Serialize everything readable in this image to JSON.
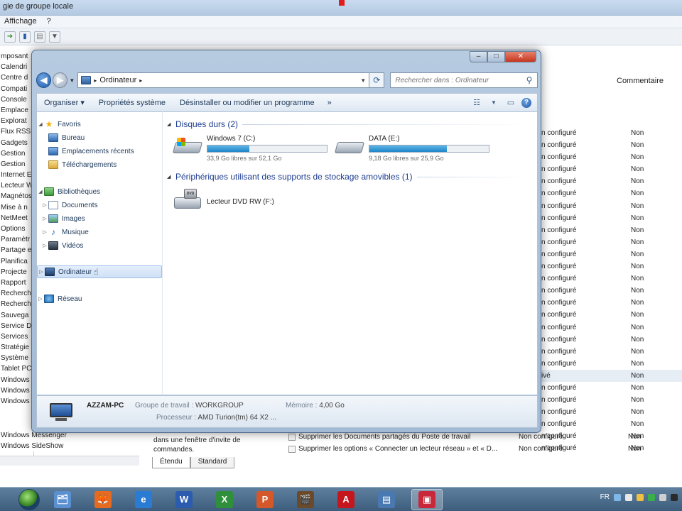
{
  "bg": {
    "title": "gie de groupe locale",
    "menu": [
      "Affichage",
      "?"
    ],
    "tree": [
      "mposant",
      "Calendri",
      "Centre d",
      "Compati",
      "Console",
      "Emplace",
      "Explorat",
      "Flux RSS",
      "Gadgets",
      "Gestion",
      "Gestion",
      "Internet E",
      "Lecteur W",
      "Magnétos",
      "Mise à n",
      "NetMeet",
      "Options",
      "Paramètr",
      "Partage e",
      "Planifica",
      "Projecte",
      "Rapport",
      "Recherch",
      "Recherch",
      "Sauvega",
      "Service D",
      "Services",
      "Stratégie",
      "Système",
      "Tablet PC",
      "Windows",
      "Windows",
      "Windows"
    ],
    "tree_tail": [
      "Windows Messenger",
      "Windows SideShow"
    ],
    "col_comment": "Commentaire",
    "rows": [
      {
        "state": "n configuré",
        "comment": "Non"
      },
      {
        "state": "n configuré",
        "comment": "Non"
      },
      {
        "state": "n configuré",
        "comment": "Non"
      },
      {
        "state": "n configuré",
        "comment": "Non"
      },
      {
        "state": "n configuré",
        "comment": "Non"
      },
      {
        "state": "n configuré",
        "comment": "Non"
      },
      {
        "state": "n configuré",
        "comment": "Non"
      },
      {
        "state": "n configuré",
        "comment": "Non"
      },
      {
        "state": "n configuré",
        "comment": "Non"
      },
      {
        "state": "n configuré",
        "comment": "Non"
      },
      {
        "state": "n configuré",
        "comment": "Non"
      },
      {
        "state": "n configuré",
        "comment": "Non"
      },
      {
        "state": "n configuré",
        "comment": "Non"
      },
      {
        "state": "n configuré",
        "comment": "Non"
      },
      {
        "state": "n configuré",
        "comment": "Non"
      },
      {
        "state": "n configuré",
        "comment": "Non"
      },
      {
        "state": "n configuré",
        "comment": "Non"
      },
      {
        "state": "n configuré",
        "comment": "Non"
      },
      {
        "state": "n configuré",
        "comment": "Non"
      },
      {
        "state": "n configuré",
        "comment": "Non"
      },
      {
        "state": "ivé",
        "comment": "Non"
      },
      {
        "state": "n configuré",
        "comment": "Non"
      },
      {
        "state": "n configuré",
        "comment": "Non"
      },
      {
        "state": "n configuré",
        "comment": "Non"
      },
      {
        "state": "n configuré",
        "comment": "Non"
      },
      {
        "state": "n configuré",
        "comment": "Non"
      },
      {
        "state": "n configuré",
        "comment": "Non"
      }
    ],
    "desc": "dans une fenêtre d'invite de commandes.",
    "policies": [
      {
        "name": "Supprimer les Documents partagés du Poste de travail",
        "state": "Non configuré",
        "comment": "Non"
      },
      {
        "name": "Supprimer les options « Connecter un lecteur réseau » et « D...",
        "state": "Non configuré",
        "comment": "Non"
      }
    ],
    "tabs": [
      "Étendu",
      "Standard"
    ]
  },
  "explorer": {
    "nav_arrow_back": "◀",
    "nav_arrow_fwd": "▶",
    "address": "Ordinateur",
    "search_placeholder": "Rechercher dans : Ordinateur",
    "commands": [
      "Organiser ▾",
      "Propriétés système",
      "Désinstaller ou modifier un programme"
    ],
    "cmd_more": "»",
    "nav_items": [
      {
        "label": "Favoris",
        "icon": "star-icon"
      },
      {
        "label": "Bureau",
        "icon": "desktop-icon"
      },
      {
        "label": "Emplacements récents",
        "icon": "recent-places-icon"
      },
      {
        "label": "Téléchargements",
        "icon": "downloads-icon"
      },
      {
        "label": "Bibliothèques",
        "icon": "libraries-icon"
      },
      {
        "label": "Documents",
        "icon": "documents-icon"
      },
      {
        "label": "Images",
        "icon": "images-icon"
      },
      {
        "label": "Musique",
        "icon": "music-icon"
      },
      {
        "label": "Vidéos",
        "icon": "videos-icon"
      },
      {
        "label": "Ordinateur",
        "icon": "computer-icon"
      },
      {
        "label": "Réseau",
        "icon": "network-icon"
      }
    ],
    "groups": {
      "hdd": "Disques durs (2)",
      "removable": "Périphériques utilisant des supports de stockage amovibles (1)"
    },
    "drives": [
      {
        "name": "Windows 7 (C:)",
        "free": "33,9 Go libres sur 52,1 Go",
        "used_fraction": 0.35
      },
      {
        "name": "DATA (E:)",
        "free": "9,18 Go libres sur 25,9 Go",
        "used_fraction": 0.65
      }
    ],
    "dvd": {
      "name": "Lecteur DVD RW (F:)",
      "label": "DVD"
    },
    "details": {
      "computer": "AZZAM-PC",
      "workgroup_key": "Groupe de travail :",
      "workgroup_val": "WORKGROUP",
      "memory_key": "Mémoire :",
      "memory_val": "4,00 Go",
      "cpu_key": "Processeur :",
      "cpu_val": "AMD Turion(tm) 64 X2 ..."
    }
  },
  "taskbar": {
    "lang": "FR",
    "apps": [
      {
        "name": "explorer-app",
        "glyph": "🗂",
        "color": "#5a8fd0"
      },
      {
        "name": "firefox-app",
        "glyph": "🦊",
        "color": "#e66a1f"
      },
      {
        "name": "ie-app",
        "glyph": "e",
        "color": "#2a7bd4"
      },
      {
        "name": "word-app",
        "glyph": "W",
        "color": "#2b5cb0"
      },
      {
        "name": "excel-app",
        "glyph": "X",
        "color": "#2f8f3a"
      },
      {
        "name": "powerpoint-app",
        "glyph": "P",
        "color": "#d4582a"
      },
      {
        "name": "media-app",
        "glyph": "🎬",
        "color": "#6a4a2a"
      },
      {
        "name": "acrobat-app",
        "glyph": "A",
        "color": "#c4161c"
      },
      {
        "name": "explorer-window-app",
        "glyph": "▤",
        "color": "#4a78b0"
      },
      {
        "name": "gpedit-app",
        "glyph": "▣",
        "color": "#c8283a"
      }
    ]
  }
}
